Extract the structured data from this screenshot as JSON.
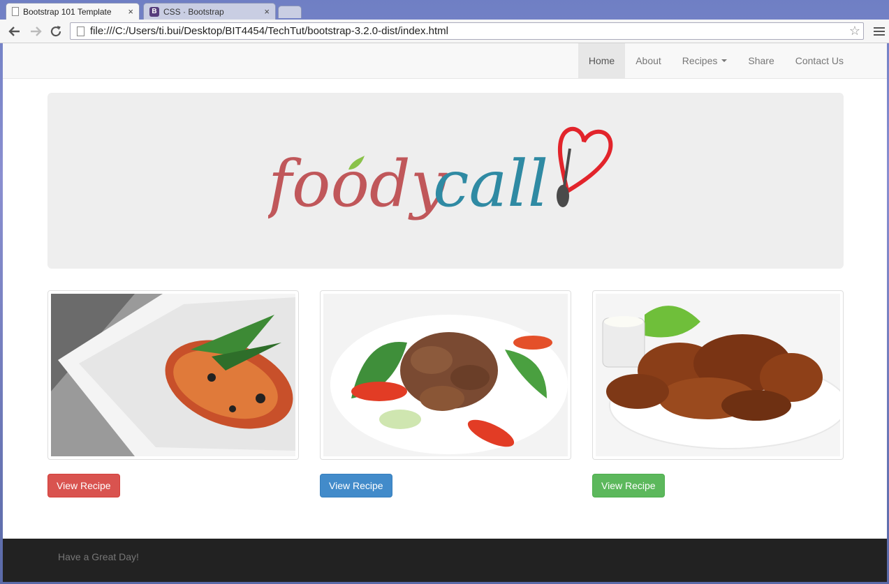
{
  "browser": {
    "tabs": [
      {
        "title": "Bootstrap 101 Template",
        "active": true,
        "icon": "page-icon"
      },
      {
        "title": "CSS · Bootstrap",
        "active": false,
        "icon": "bootstrap-icon"
      }
    ],
    "close_glyph": "×",
    "url": "file:///C:/Users/ti.bui/Desktop/BIT4454/TechTut/bootstrap-3.2.0-dist/index.html"
  },
  "navbar": {
    "items": [
      {
        "label": "Home",
        "active": true
      },
      {
        "label": "About"
      },
      {
        "label": "Recipes",
        "dropdown": true
      },
      {
        "label": "Share"
      },
      {
        "label": "Contact Us"
      }
    ]
  },
  "jumbotron": {
    "logo_text_left": "foody",
    "logo_text_right": "call",
    "logo_colors": {
      "foody": "#c0575a",
      "call": "#2f8aa3",
      "heart": "#e2242b",
      "leaf": "#8ac24a"
    }
  },
  "cards": [
    {
      "image": "spaghetti-photo",
      "button_label": "View Recipe",
      "button_color": "#d9534f"
    },
    {
      "image": "beef-salad-photo",
      "button_label": "View Recipe",
      "button_color": "#428bca"
    },
    {
      "image": "chicken-wings-photo",
      "button_label": "View Recipe",
      "button_color": "#5cb85c"
    }
  ],
  "footer": {
    "text": "Have a Great Day!"
  }
}
